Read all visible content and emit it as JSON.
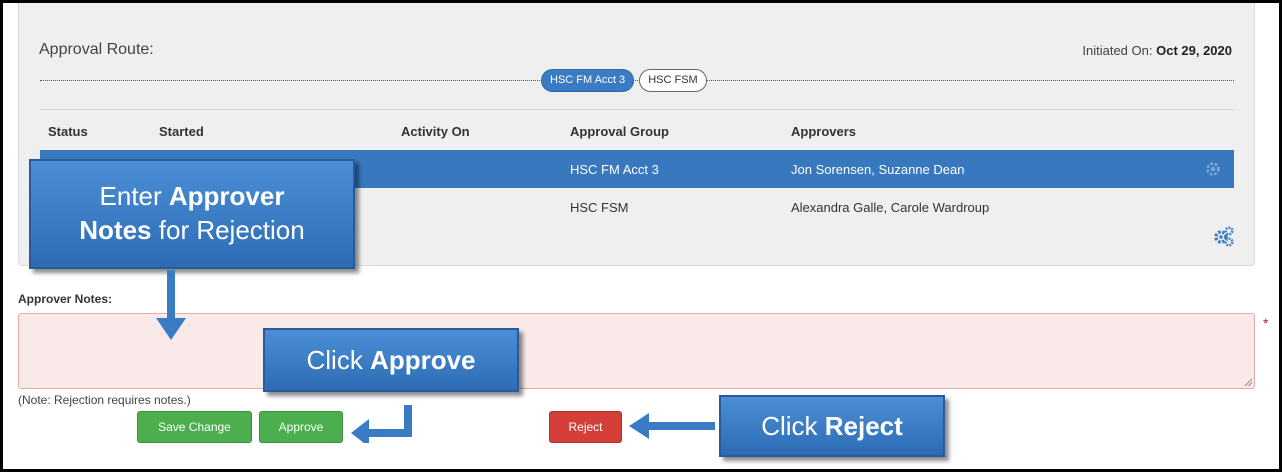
{
  "route": {
    "title": "Approval Route:",
    "initiated_label": "Initiated On:",
    "initiated_date": "Oct 29, 2020",
    "stages": [
      "HSC FM Acct 3",
      "HSC FSM"
    ]
  },
  "table": {
    "headers": [
      "Status",
      "Started",
      "Activity On",
      "Approval Group",
      "Approvers"
    ],
    "rows": [
      {
        "group": "HSC FM Acct 3",
        "approvers": "Jon Sorensen, Suzanne Dean",
        "selected": true
      },
      {
        "group": "HSC FSM",
        "approvers": "Alexandra Galle, Carole Wardroup",
        "selected": false
      }
    ]
  },
  "notes": {
    "label": "Approver Notes:",
    "value": "",
    "required_mark": "*",
    "hint": "(Note: Rejection requires notes.)"
  },
  "buttons": {
    "save": "Save Change",
    "approve": "Approve",
    "reject": "Reject"
  },
  "callouts": {
    "notes": {
      "pre": "Enter ",
      "bold1": "Approver",
      "bold2": "Notes",
      "post": " for Rejection"
    },
    "approve": {
      "pre": "Click ",
      "bold": "Approve"
    },
    "reject": {
      "pre": "Click ",
      "bold": "Reject"
    }
  },
  "colors": {
    "selected_row": "#3778bf",
    "green_button": "#4cae4c",
    "red_button": "#d43f3a",
    "callout_blue": "#3a7cc4"
  },
  "icons": [
    "gear-icon",
    "gears-icon",
    "resize-grip-icon"
  ]
}
